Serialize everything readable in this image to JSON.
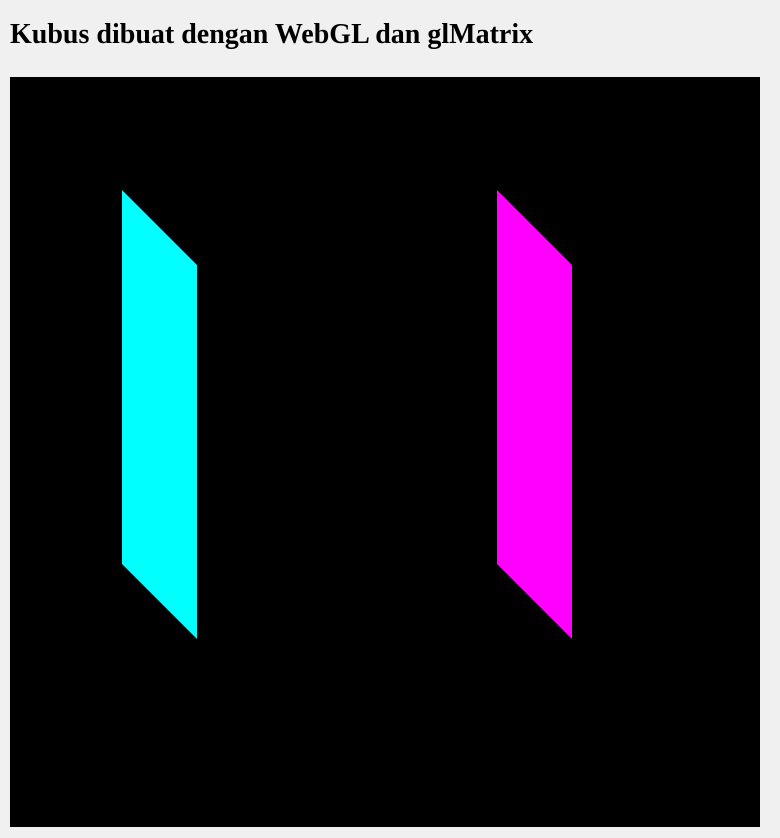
{
  "page": {
    "title": "Kubus dibuat dengan WebGL dan glMatrix"
  },
  "scene": {
    "background_color": "#000000",
    "faces": [
      {
        "name": "cyan-face",
        "color": "#00ffff"
      },
      {
        "name": "magenta-face",
        "color": "#ff00ff"
      }
    ]
  }
}
